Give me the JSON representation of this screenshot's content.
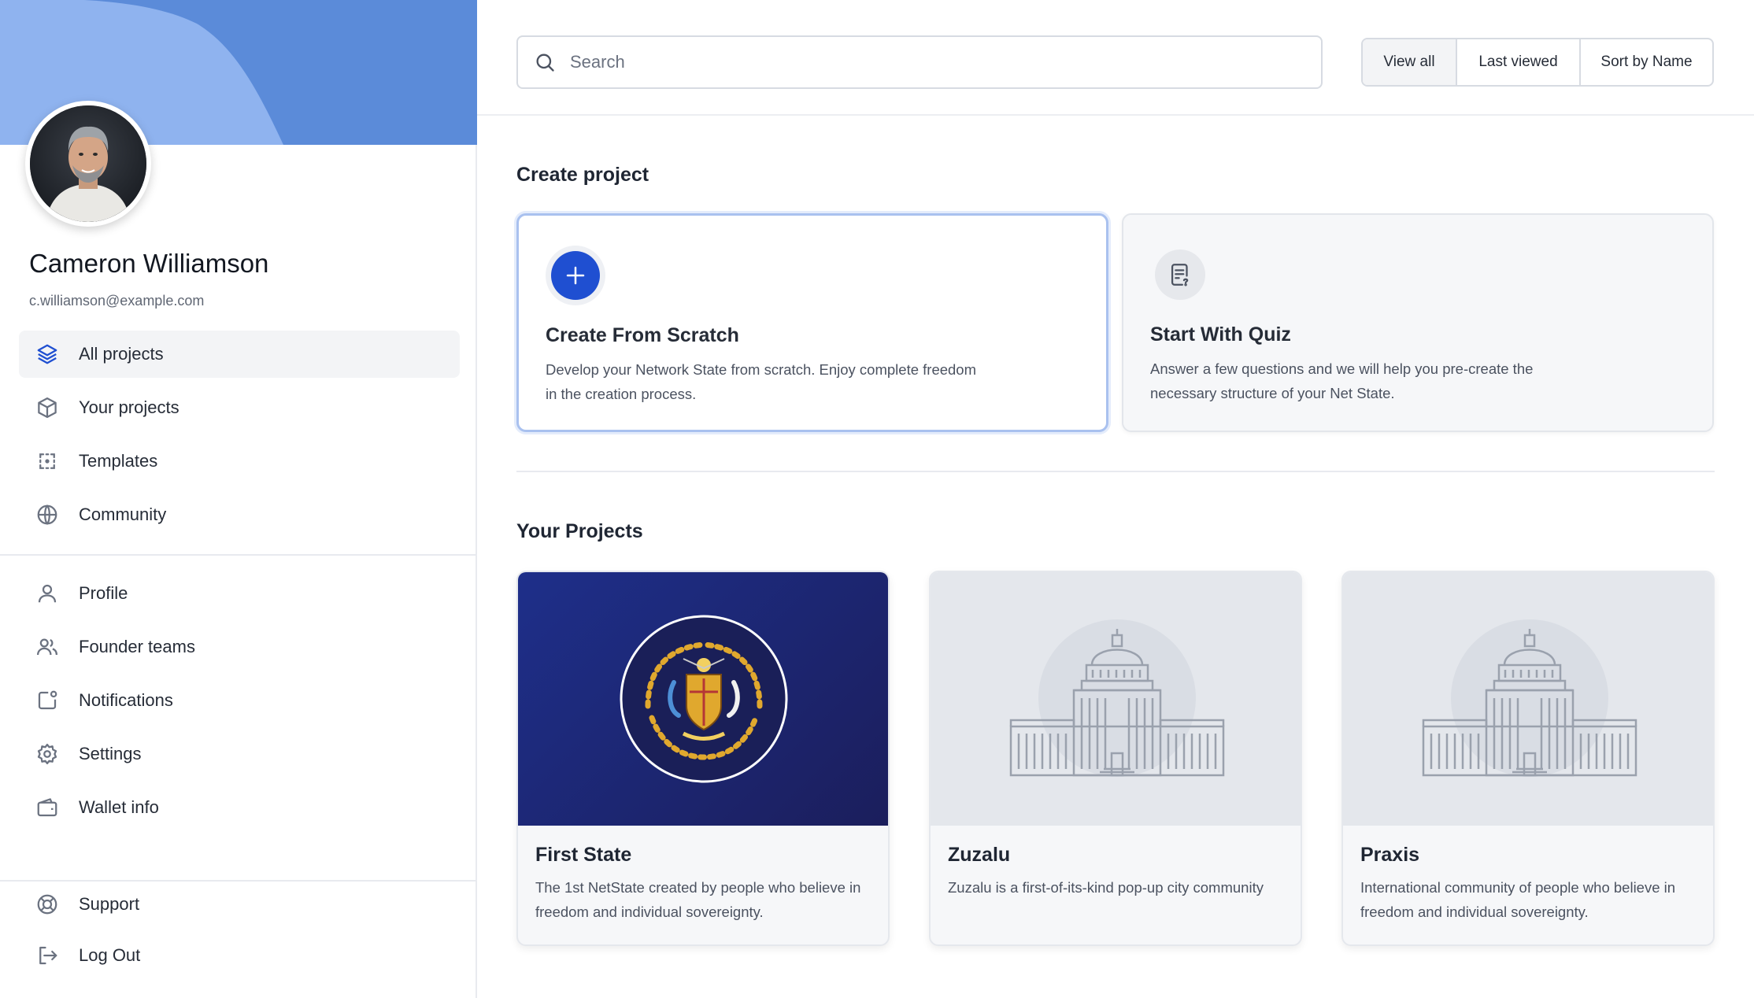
{
  "user": {
    "name": "Cameron Williamson",
    "email": "c.williamson@example.com"
  },
  "sidebar": {
    "primary_items": [
      {
        "label": "All projects",
        "icon": "layers-icon",
        "active": true
      },
      {
        "label": "Your projects",
        "icon": "cube-icon",
        "active": false
      },
      {
        "label": "Templates",
        "icon": "templates-icon",
        "active": false
      },
      {
        "label": "Community",
        "icon": "globe-icon",
        "active": false
      }
    ],
    "secondary_items": [
      {
        "label": "Profile",
        "icon": "user-icon"
      },
      {
        "label": "Founder teams",
        "icon": "users-icon"
      },
      {
        "label": "Notifications",
        "icon": "notification-icon"
      },
      {
        "label": "Settings",
        "icon": "gear-icon"
      },
      {
        "label": "Wallet info",
        "icon": "wallet-icon"
      }
    ],
    "footer_items": [
      {
        "label": "Support",
        "icon": "lifebuoy-icon"
      },
      {
        "label": "Log Out",
        "icon": "logout-icon"
      }
    ]
  },
  "search": {
    "placeholder": "Search",
    "value": ""
  },
  "view_filters": [
    "View all",
    "Last viewed",
    "Sort by Name"
  ],
  "create_section": {
    "title": "Create project",
    "cards": [
      {
        "title": "Create From Scratch",
        "description": "Develop your Network State from scratch. Enjoy complete freedom in the creation process.",
        "icon": "plus-icon"
      },
      {
        "title": "Start With Quiz",
        "description": "Answer a few questions and we will help you pre-create the necessary structure of your Net State.",
        "icon": "quiz-icon"
      }
    ]
  },
  "projects_section": {
    "title": "Your Projects",
    "projects": [
      {
        "name": "First State",
        "description": "The 1st NetState created by people who believe in freedom and individual sovereignty.",
        "image": "coat-of-arms"
      },
      {
        "name": "Zuzalu",
        "description": "Zuzalu is a first-of-its-kind pop-up city community",
        "image": "capitol-building"
      },
      {
        "name": "Praxis",
        "description": "International community of people who believe in freedom and individual sovereignty.",
        "image": "capitol-building"
      }
    ]
  },
  "colors": {
    "accent": "#1f4fd1",
    "cover": "#5b8bd9",
    "project_dark": "#1e2f8a"
  }
}
